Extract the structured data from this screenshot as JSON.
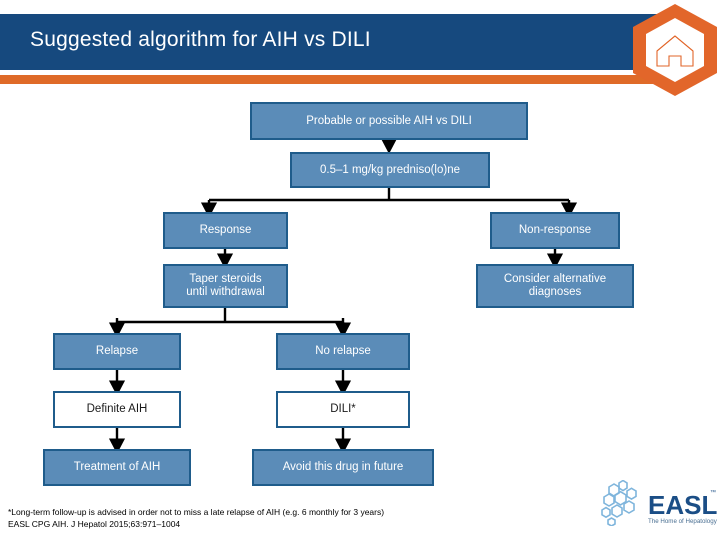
{
  "header": {
    "title": "Suggested algorithm for AIH vs DILI",
    "bar_color": "#16497E",
    "accent_color": "#DF6A28"
  },
  "logo_hex": {
    "name": "home-hexagon-logo",
    "outer_color": "#E2662A",
    "inner_color": "#FFFFFF"
  },
  "flow": {
    "node_fill": "#5B8CB8",
    "node_border": "#1F5C8B",
    "nodes": [
      {
        "id": "probable",
        "label": "Probable or possible AIH vs DILI"
      },
      {
        "id": "prednisolone",
        "label": "0.5–1 mg/kg predniso(lo)ne"
      },
      {
        "id": "response",
        "label": "Response"
      },
      {
        "id": "non-response",
        "label": "Non-response"
      },
      {
        "id": "taper",
        "label": "Taper steroids\nuntil withdrawal"
      },
      {
        "id": "alternative",
        "label": "Consider alternative\ndiagnoses"
      },
      {
        "id": "relapse",
        "label": "Relapse"
      },
      {
        "id": "no-relapse",
        "label": "No relapse"
      },
      {
        "id": "definite-aih",
        "label": "Definite AIH"
      },
      {
        "id": "dili",
        "label": "DILI*"
      },
      {
        "id": "treatment-aih",
        "label": "Treatment of AIH"
      },
      {
        "id": "avoid-drug",
        "label": "Avoid this drug in future"
      }
    ]
  },
  "footnote": {
    "line1": "*Long-term follow-up is advised in order not to miss a late relapse of AIH (e.g. 6 monthly for 3 years)",
    "line2": "EASL CPG AIH. J Hepatol 2015;63:971–1004"
  },
  "easl_logo": {
    "wordmark": "EASL",
    "trademark": "™",
    "tagline": "The Home of Hepatology",
    "color": "#1B4E86"
  }
}
